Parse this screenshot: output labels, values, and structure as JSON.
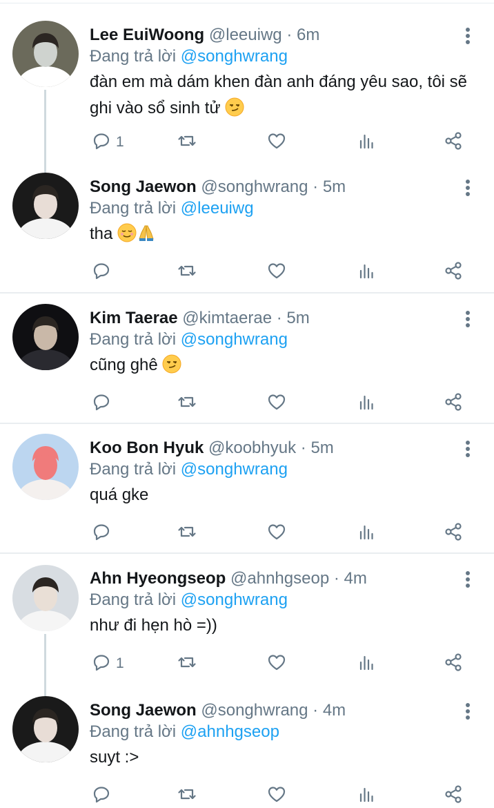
{
  "tweets": [
    {
      "name": "Lee EuiWoong",
      "handle": "@leeuiwg",
      "time": "6m",
      "reply_prefix": "Đang trả lời",
      "reply_to": "@songhwrang",
      "text": "đàn em mà dám khen đàn anh đáng yêu sao, tôi sẽ ghi vào sổ sinh tử",
      "reply_count": "1",
      "emoji": [
        "smirk"
      ]
    },
    {
      "name": "Song Jaewon",
      "handle": "@songhwrang",
      "time": "5m",
      "reply_prefix": "Đang trả lời",
      "reply_to": "@leeuiwg",
      "text": "tha",
      "reply_count": "",
      "emoji": [
        "relieved",
        "pray"
      ]
    },
    {
      "name": "Kim Taerae",
      "handle": "@kimtaerae",
      "time": "5m",
      "reply_prefix": "Đang trả lời",
      "reply_to": "@songhwrang",
      "text": "cũng ghê",
      "reply_count": "",
      "emoji": [
        "smirk"
      ]
    },
    {
      "name": "Koo Bon Hyuk",
      "handle": "@koobhyuk",
      "time": "5m",
      "reply_prefix": "Đang trả lời",
      "reply_to": "@songhwrang",
      "text": "quá gke",
      "reply_count": "",
      "emoji": []
    },
    {
      "name": "Ahn Hyeongseop",
      "handle": "@ahnhgseop",
      "time": "4m",
      "reply_prefix": "Đang trả lời",
      "reply_to": "@songhwrang",
      "text": "như đi hẹn hò =))",
      "reply_count": "1",
      "emoji": []
    },
    {
      "name": "Song Jaewon",
      "handle": "@songhwrang",
      "time": "4m",
      "reply_prefix": "Đang trả lời",
      "reply_to": "@ahnhgseop",
      "text": "suyt :>",
      "reply_count": "",
      "emoji": []
    }
  ],
  "separator": "·",
  "icons": {
    "reply": "reply-icon",
    "retweet": "retweet-icon",
    "like": "heart-icon",
    "analytics": "analytics-icon",
    "share": "share-icon",
    "more": "more-vertical-icon"
  },
  "colors": {
    "accent": "#1da1f2",
    "muted": "#657786",
    "text": "#14171a",
    "divider": "#e9edf0"
  }
}
